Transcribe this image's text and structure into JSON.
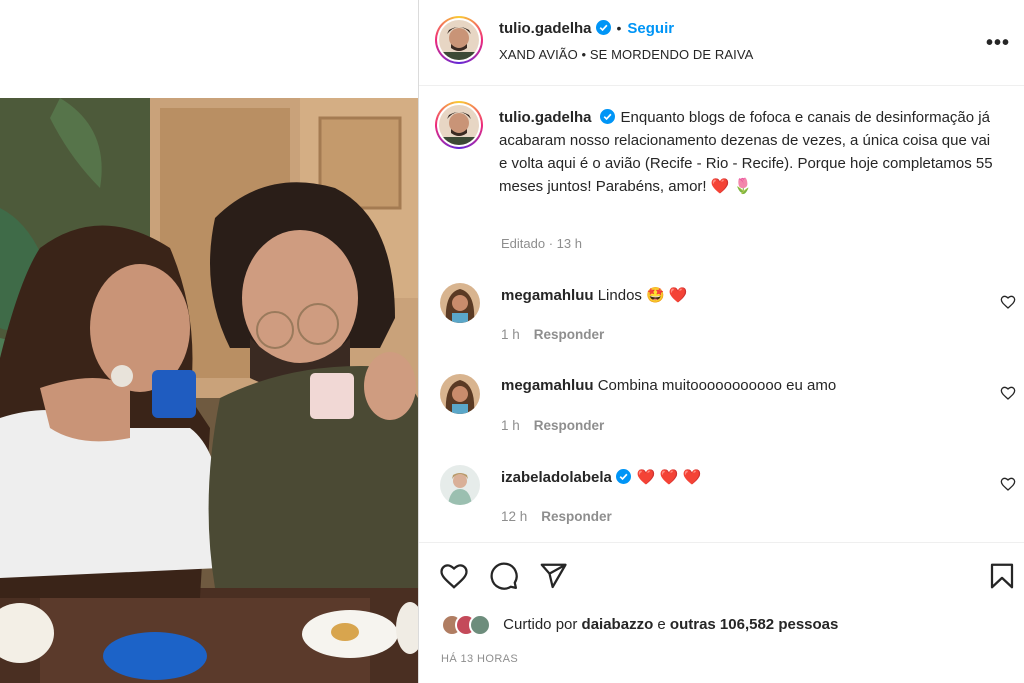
{
  "post": {
    "username": "tulio.gadelha",
    "follow_label": "Seguir",
    "dot": "•",
    "audio": "XAND AVIÃO • SE MORDENDO DE RAIVA",
    "more": "•••",
    "caption_text": "Enquanto blogs de fofoca e canais de desinformação já acabaram nosso relacionamento dezenas de vezes, a única coisa que vai e volta aqui é o avião (Recife - Rio - Recife). Porque hoje completamos 55 meses juntos! Parabéns, amor! ❤️ 🌷",
    "caption_meta": "Editado · 13 h"
  },
  "comments": [
    {
      "username": "megamahluu",
      "text": "Lindos 🤩 ❤️",
      "time": "1 h",
      "reply": "Responder",
      "verified": false
    },
    {
      "username": "megamahluu",
      "text": "Combina muitooooooooooo eu amo",
      "time": "1 h",
      "reply": "Responder",
      "verified": false
    },
    {
      "username": "izabeladolabela",
      "text": "❤️ ❤️ ❤️",
      "time": "12 h",
      "reply": "Responder",
      "verified": true
    }
  ],
  "footer": {
    "liked_prefix": "Curtido por",
    "liked_user": "daiabazzo",
    "liked_mid": "e",
    "liked_others": "outras 106,582 pessoas",
    "time_ago": "HÁ 13 HORAS"
  },
  "icons": {
    "like": "heart-icon",
    "comment": "comment-icon",
    "share": "send-icon",
    "save": "bookmark-icon",
    "verified": "verified-badge-icon"
  },
  "colors": {
    "accent": "#0095f6",
    "heart": "#ed4956"
  }
}
